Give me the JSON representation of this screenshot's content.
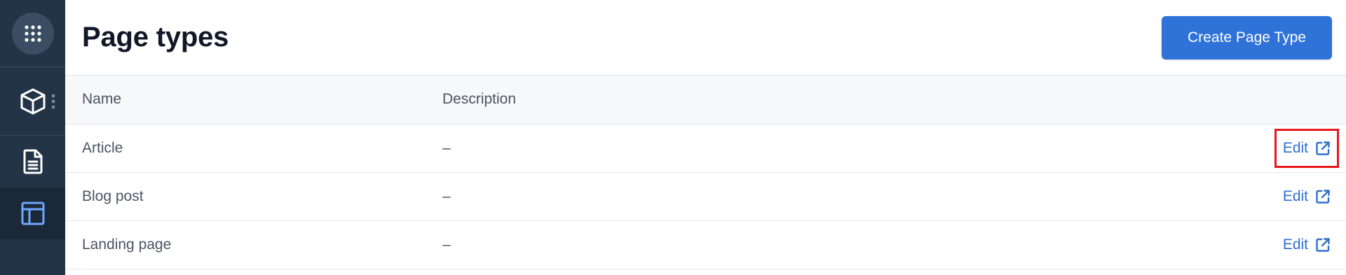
{
  "sidebar": {
    "items": [
      {
        "name": "apps-menu",
        "icon": "grid-dots-icon"
      },
      {
        "name": "products",
        "icon": "cube-icon"
      },
      {
        "name": "pages",
        "icon": "document-icon"
      },
      {
        "name": "page-types",
        "icon": "layout-icon",
        "active": true
      }
    ],
    "active_color": "#6fa8ff"
  },
  "header": {
    "title": "Page types",
    "create_label": "Create Page Type"
  },
  "table": {
    "columns": {
      "name": "Name",
      "description": "Description"
    },
    "rows": [
      {
        "name": "Article",
        "description": "–",
        "action": "Edit",
        "highlighted": true
      },
      {
        "name": "Blog post",
        "description": "–",
        "action": "Edit"
      },
      {
        "name": "Landing page",
        "description": "–",
        "action": "Edit"
      }
    ]
  },
  "colors": {
    "accent": "#2f72d8",
    "sidebar_bg": "#243447",
    "highlight": "#e8161c"
  }
}
